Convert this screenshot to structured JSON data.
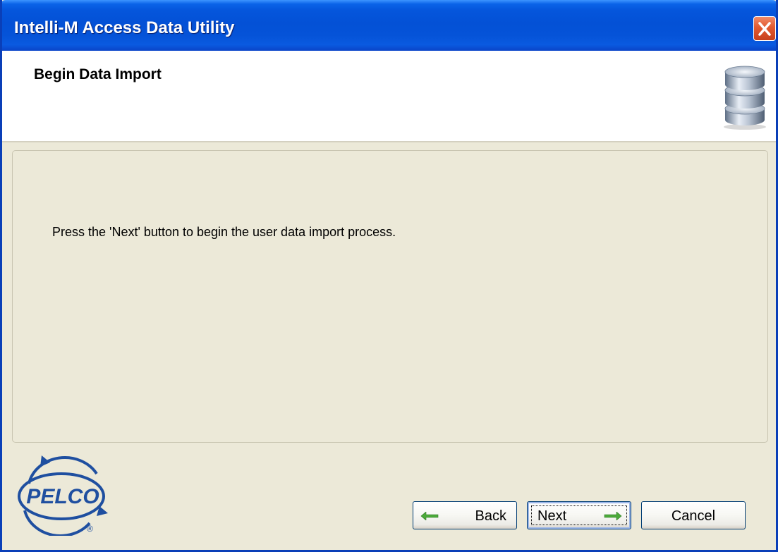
{
  "window": {
    "title": "Intelli-M Access Data Utility"
  },
  "header": {
    "title": "Begin Data Import",
    "icon": "database-icon"
  },
  "content": {
    "instruction": "Press the 'Next' button to begin the user data import process."
  },
  "logo": {
    "text": "PELCO",
    "mark": "®"
  },
  "buttons": {
    "back": "Back",
    "next": "Next",
    "cancel": "Cancel"
  },
  "colors": {
    "titlebar": "#0451d6",
    "dialog_bg": "#ece9d8",
    "header_bg": "#ffffff",
    "close_button": "#e25a30",
    "logo_blue": "#1f4fa0",
    "arrow_green": "#4caa3a"
  }
}
